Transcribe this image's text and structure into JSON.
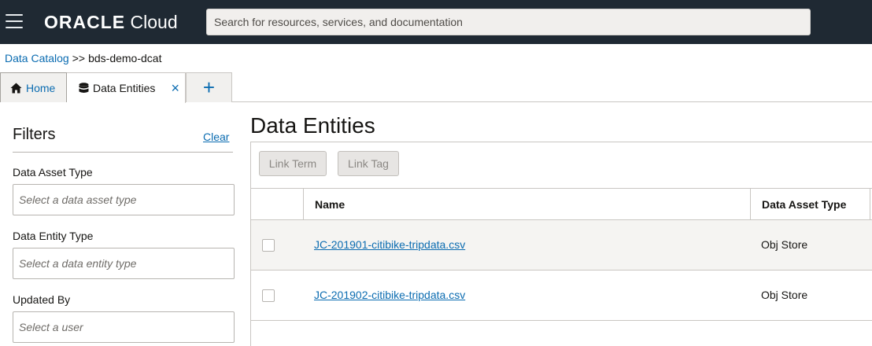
{
  "header": {
    "brand_oracle": "ORACLE",
    "brand_cloud": "Cloud",
    "search_placeholder": "Search for resources, services, and documentation"
  },
  "breadcrumb": {
    "root": "Data Catalog",
    "separator": ">>",
    "current": "bds-demo-dcat"
  },
  "tabs": {
    "home_label": "Home",
    "entities_label": "Data Entities",
    "close_symbol": "×",
    "add_symbol": "+"
  },
  "filters": {
    "title": "Filters",
    "clear_label": "Clear",
    "asset_type_label": "Data Asset Type",
    "asset_type_placeholder": "Select a data asset type",
    "entity_type_label": "Data Entity Type",
    "entity_type_placeholder": "Select a data entity type",
    "updated_by_label": "Updated By",
    "updated_by_placeholder": "Select a user"
  },
  "main": {
    "title": "Data Entities",
    "link_term_label": "Link Term",
    "link_tag_label": "Link Tag"
  },
  "table": {
    "columns": [
      "Name",
      "Data Asset Type"
    ],
    "rows": [
      {
        "name": "JC-201901-citibike-tripdata.csv",
        "type": "Obj Store"
      },
      {
        "name": "JC-201902-citibike-tripdata.csv",
        "type": "Obj Store"
      }
    ]
  },
  "icons": {
    "menu": "hamburger-menu-icon",
    "home": "home-icon",
    "entities": "database-icon",
    "close": "close-icon",
    "add": "plus-icon"
  },
  "colors": {
    "header_bg": "#1f2933",
    "link": "#0b6cb1",
    "text": "#161513"
  }
}
